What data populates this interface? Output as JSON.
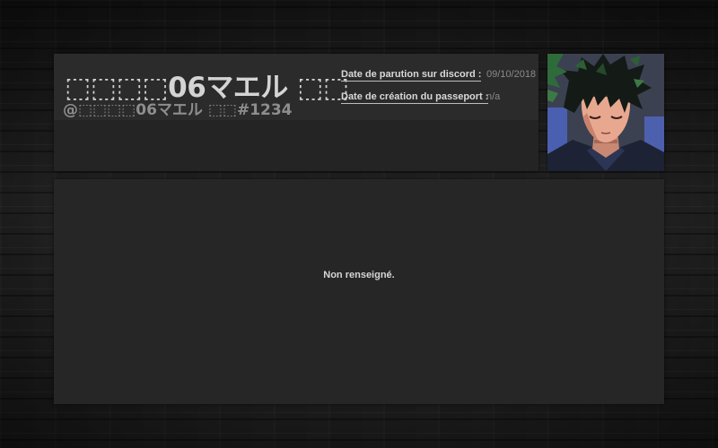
{
  "profile": {
    "display_name": "⬚⬚⬚⬚06マエル ⬚⬚",
    "handle": "@⬚⬚⬚⬚06マエル ⬚⬚#1234",
    "avatar_icon": "anime-character-avatar"
  },
  "info": [
    {
      "label": "Date de parution sur discord :",
      "value": "09/10/2018"
    },
    {
      "label": "Date de création du passeport :",
      "value": "n/a"
    }
  ],
  "bio": {
    "text": "Non renseigné."
  },
  "colors": {
    "panel": "#242424",
    "panel_band": "#2b2b2b",
    "text_primary": "#d4d4d4",
    "text_secondary": "#8e8e8e"
  }
}
